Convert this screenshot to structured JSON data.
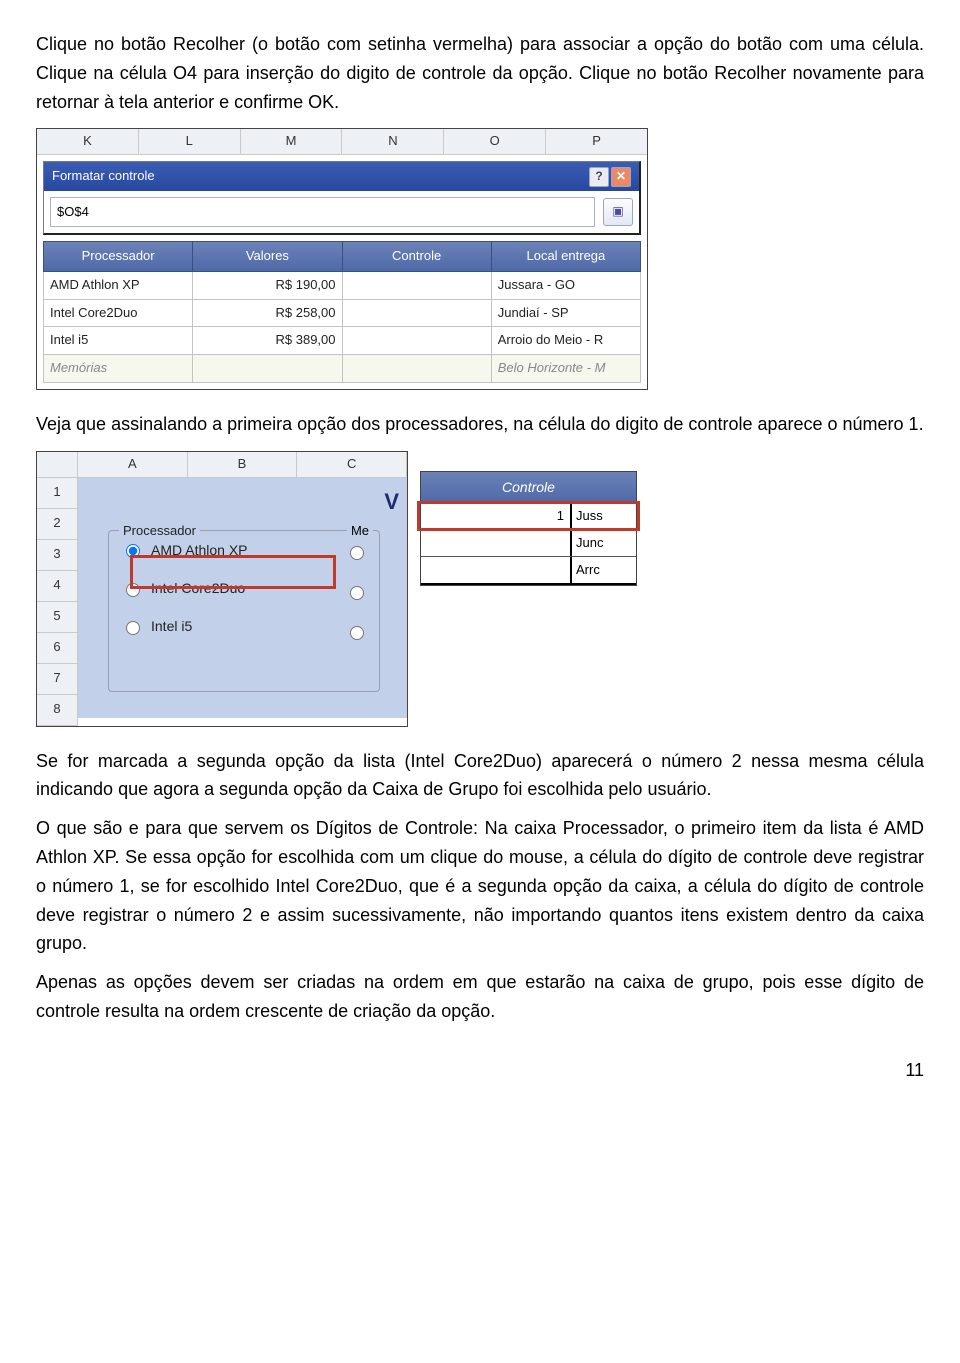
{
  "para": {
    "p1": "Clique no botão Recolher (o botão com setinha vermelha) para associar a opção do botão com uma célula. Clique na célula O4 para inserção do digito de controle da opção. Clique no botão Recolher novamente para retornar à tela anterior e confirme OK.",
    "p2": "Veja que assinalando a primeira opção dos processadores, na célula do digito de controle aparece o número 1.",
    "p3": "Se for marcada a segunda opção da lista (Intel Core2Duo) aparecerá o número 2 nessa mesma célula indicando que agora a segunda opção da Caixa de Grupo foi escolhida pelo usuário.",
    "p4": "O que são e para que servem os Dígitos de Controle: Na caixa Processador, o primeiro item da lista é AMD Athlon XP. Se essa opção for escolhida com um clique do mouse, a célula do dígito de controle deve registrar o número 1, se for escolhido Intel Core2Duo, que é a segunda opção da caixa, a célula do dígito de controle deve registrar o número 2 e assim sucessivamente, não importando quantos itens existem dentro da caixa grupo.",
    "p5": "Apenas as opções devem ser criadas na ordem em que estarão na caixa de grupo, pois esse dígito de controle resulta na ordem crescente de criação da opção."
  },
  "page_number": "11",
  "fig1": {
    "cols": [
      "K",
      "L",
      "M",
      "N",
      "O",
      "P"
    ],
    "dialog_title": "Formatar controle",
    "input_value": "$O$4",
    "help_label": "?",
    "close_label": "✕",
    "expand_label": "▣",
    "headers": [
      "Processador",
      "Valores",
      "Controle",
      "Local entrega"
    ],
    "rows": [
      {
        "proc": "AMD Athlon XP",
        "valor": "R$    190,00",
        "ctrl": "",
        "local": "Jussara - GO"
      },
      {
        "proc": "Intel Core2Duo",
        "valor": "R$    258,00",
        "ctrl": "",
        "local": "Jundiaí - SP"
      },
      {
        "proc": "Intel i5",
        "valor": "R$    389,00",
        "ctrl": "",
        "local": "Arroio do Meio - R"
      }
    ],
    "footer_label": "Memórias",
    "footer_local": "Belo Horizonte - M"
  },
  "fig2a": {
    "cols": [
      "A",
      "B",
      "C"
    ],
    "rows": [
      "1",
      "2",
      "3",
      "4",
      "5",
      "6",
      "7",
      "8"
    ],
    "title": "V",
    "group_label": "Processador",
    "me_label": "Me",
    "options": [
      "AMD Athlon XP",
      "Intel Core2Duo",
      "Intel i5"
    ]
  },
  "fig2b": {
    "header": "Controle",
    "cells": [
      {
        "left": "1",
        "right": "Juss"
      },
      {
        "left": "",
        "right": "Junc"
      },
      {
        "left": "",
        "right": "Arrc"
      }
    ]
  }
}
